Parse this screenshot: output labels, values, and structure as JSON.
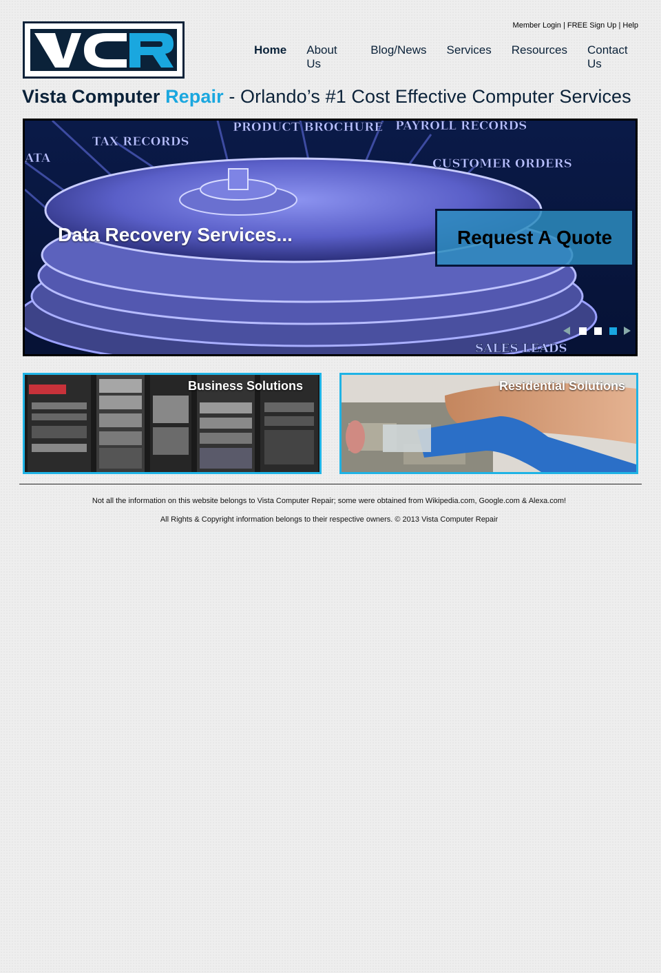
{
  "header": {
    "logo_text": "VCR",
    "top_links": {
      "member_login": "Member Login",
      "separator": "|",
      "sign_up": "FREE Sign Up",
      "help": "Help"
    },
    "nav": [
      "Home",
      "About Us",
      "Blog/News",
      "Services",
      "Resources",
      "Contact Us"
    ],
    "active_nav": "Home"
  },
  "heading": {
    "part1": "Vista Computer",
    "part2": "Repair",
    "rest": "- Orlando’s #1 Cost Effective Computer Services"
  },
  "hero": {
    "caption": "Data Recovery Services...",
    "quote_button": "Request A Quote",
    "image_labels": [
      "TAX RECORDS",
      "PRODUCT BROCHURE",
      "PAYROLL RECORDS",
      "CUSTOMER ORDERS",
      "SALES LEADS",
      "ATA"
    ],
    "slides": 3,
    "active_slide": 3
  },
  "panels": {
    "business": "Business Solutions",
    "residential": "Residential Solutions"
  },
  "footer": {
    "line1": "Not all the information on this website belongs to Vista Computer Repair; some were obtained from Wikipedia.com, Google.com & Alexa.com!",
    "line2": "All Rights & Copyright information belongs to their respective owners. © 2013 Vista Computer Repair"
  },
  "colors": {
    "navy": "#0b2239",
    "accent": "#1aa7df",
    "panel_border": "#1fb3e5"
  }
}
